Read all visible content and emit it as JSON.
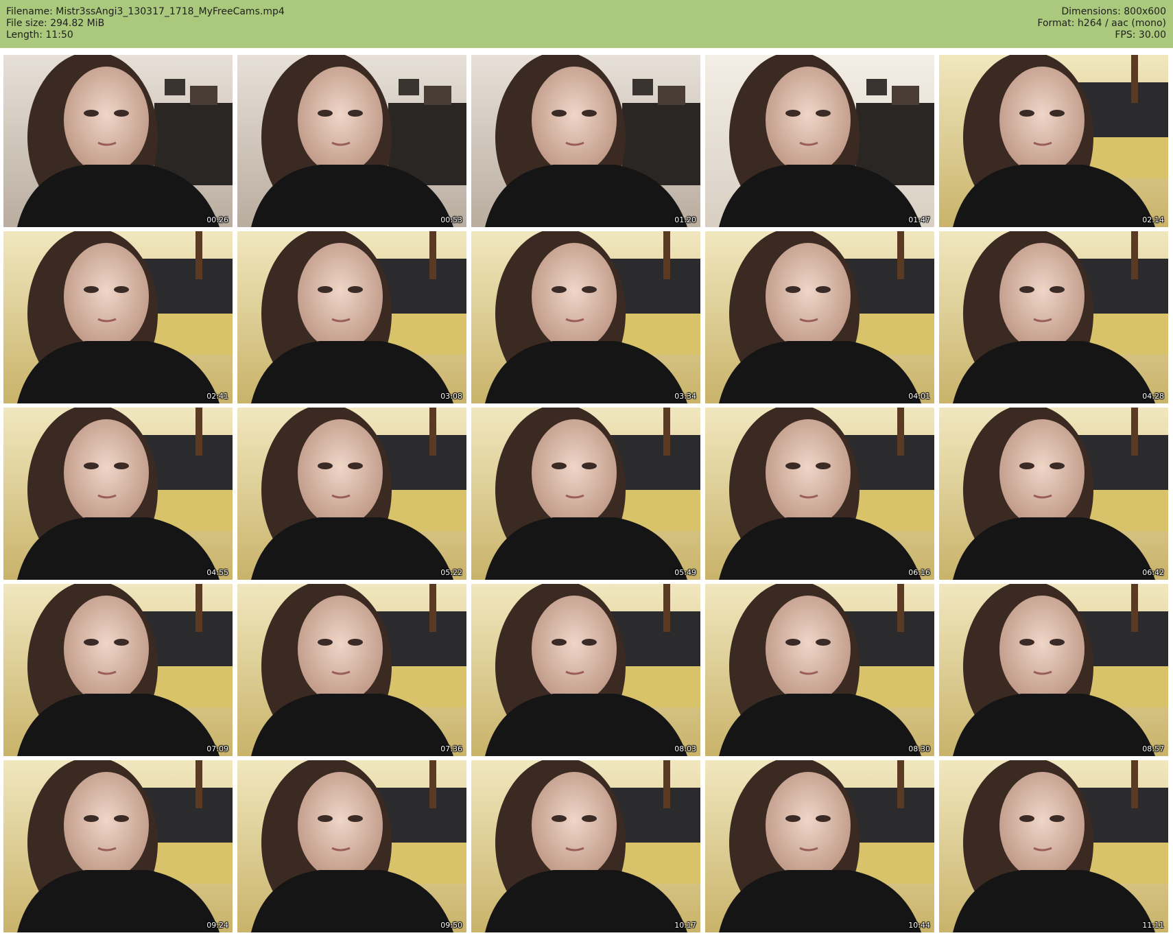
{
  "header": {
    "filename": "Filename: Mistr3ssAngi3_130317_1718_MyFreeCams.mp4",
    "filesize": "File size: 294.82 MiB",
    "length": "Length: 11:50",
    "dimensions": "Dimensions: 800x600",
    "format": "Format: h264 / aac (mono)",
    "fps": "FPS: 30.00"
  },
  "colors": {
    "header_bg": "#abc97d",
    "page_bg": "#ffffff"
  },
  "thumbnails": [
    {
      "time": "00:26",
      "bg": "light-room"
    },
    {
      "time": "00:53",
      "bg": "light-room"
    },
    {
      "time": "01:20",
      "bg": "light-room"
    },
    {
      "time": "01:47",
      "bg": "bright"
    },
    {
      "time": "02:14",
      "bg": "couch"
    },
    {
      "time": "02:41",
      "bg": "couch"
    },
    {
      "time": "03:08",
      "bg": "couch"
    },
    {
      "time": "03:34",
      "bg": "couch"
    },
    {
      "time": "04:01",
      "bg": "couch"
    },
    {
      "time": "04:28",
      "bg": "couch"
    },
    {
      "time": "04:55",
      "bg": "couch"
    },
    {
      "time": "05:22",
      "bg": "couch"
    },
    {
      "time": "05:49",
      "bg": "couch"
    },
    {
      "time": "06:16",
      "bg": "couch"
    },
    {
      "time": "06:42",
      "bg": "couch"
    },
    {
      "time": "07:09",
      "bg": "couch"
    },
    {
      "time": "07:36",
      "bg": "couch"
    },
    {
      "time": "08:03",
      "bg": "couch"
    },
    {
      "time": "08:30",
      "bg": "couch"
    },
    {
      "time": "08:57",
      "bg": "couch"
    },
    {
      "time": "09:24",
      "bg": "couch"
    },
    {
      "time": "09:50",
      "bg": "couch"
    },
    {
      "time": "10:17",
      "bg": "couch"
    },
    {
      "time": "10:44",
      "bg": "couch"
    },
    {
      "time": "11:11",
      "bg": "couch"
    }
  ]
}
